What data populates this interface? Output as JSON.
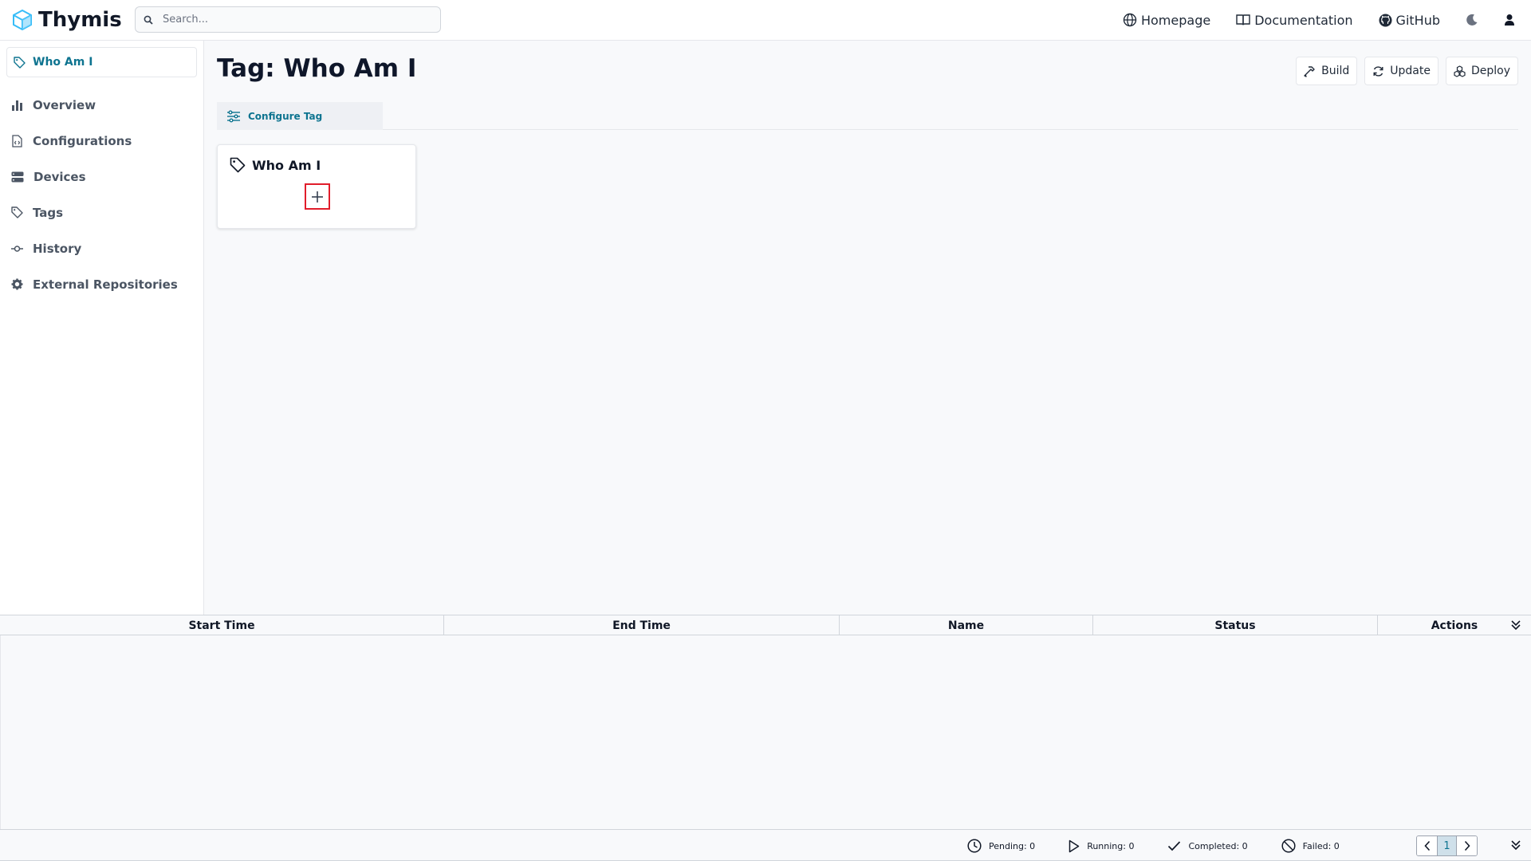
{
  "app": {
    "name": "Thymis",
    "brand_color": "#38bdf8",
    "accent_color": "#0e7490"
  },
  "search": {
    "placeholder": "Search..."
  },
  "nav": {
    "links": [
      {
        "label": "Homepage",
        "icon": "globe-icon"
      },
      {
        "label": "Documentation",
        "icon": "book-icon"
      },
      {
        "label": "GitHub",
        "icon": "github-icon"
      }
    ],
    "theme_icon": "moon-icon",
    "user_icon": "user-icon"
  },
  "sidebar": {
    "active": {
      "label": "Who Am I",
      "icon": "tag-icon"
    },
    "items": [
      {
        "label": "Overview",
        "icon": "bar-chart-icon"
      },
      {
        "label": "Configurations",
        "icon": "file-code-icon"
      },
      {
        "label": "Devices",
        "icon": "server-icon"
      },
      {
        "label": "Tags",
        "icon": "tag-icon"
      },
      {
        "label": "History",
        "icon": "commit-icon"
      },
      {
        "label": "External Repositories",
        "icon": "gear-icon"
      }
    ]
  },
  "page": {
    "title": "Tag: Who Am I"
  },
  "toolbar": {
    "build": "Build",
    "update": "Update",
    "deploy": "Deploy"
  },
  "tabs": {
    "active": "Configure Tag"
  },
  "card": {
    "title": "Who Am I"
  },
  "tasks": {
    "columns": [
      "Start Time",
      "End Time",
      "Name",
      "Status",
      "Actions"
    ],
    "rows": [],
    "counts": {
      "pending": "Pending: 0",
      "running": "Running: 0",
      "completed": "Completed: 0",
      "failed": "Failed: 0"
    },
    "page": "1"
  }
}
